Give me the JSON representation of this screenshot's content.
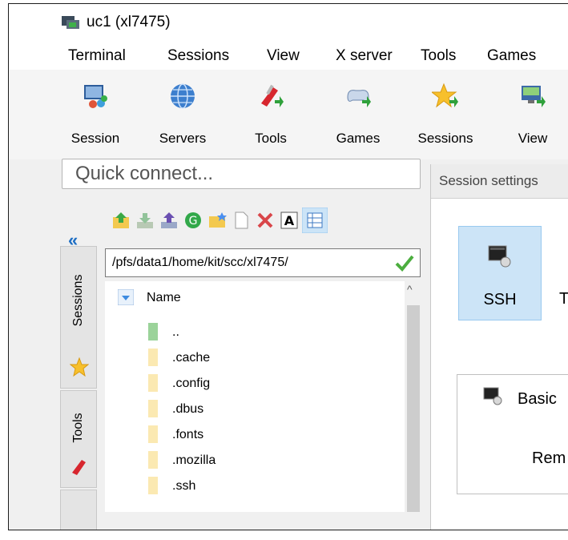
{
  "window": {
    "title": "uc1 (xl7475)"
  },
  "menu": [
    {
      "name": "menu-terminal",
      "label": "Terminal"
    },
    {
      "name": "menu-sessions",
      "label": "Sessions"
    },
    {
      "name": "menu-view",
      "label": "View"
    },
    {
      "name": "menu-x-server",
      "label": "X server"
    },
    {
      "name": "menu-tools",
      "label": "Tools"
    },
    {
      "name": "menu-games",
      "label": "Games"
    }
  ],
  "toolbar": {
    "session": "Session",
    "servers": "Servers",
    "tools": "Tools",
    "games": "Games",
    "sessions": "Sessions",
    "view": "View"
  },
  "quick_connect": {
    "placeholder": "Quick connect..."
  },
  "side_tabs": {
    "sessions": "Sessions",
    "tools": "Tools"
  },
  "browser": {
    "path": "/pfs/data1/home/kit/scc/xl7475/",
    "column_name": "Name",
    "files": [
      "..",
      ".cache",
      ".config",
      ".dbus",
      ".fonts",
      ".mozilla",
      ".ssh"
    ]
  },
  "settings": {
    "title": "Session settings",
    "ssh_label": "SSH",
    "t_label": "T",
    "basic_label": "Basic",
    "rem_label": "Rem"
  },
  "colors": {
    "accent": "#1f6fc4",
    "selected_tile": "#cce4f7",
    "folder": "#fbe9b2"
  }
}
